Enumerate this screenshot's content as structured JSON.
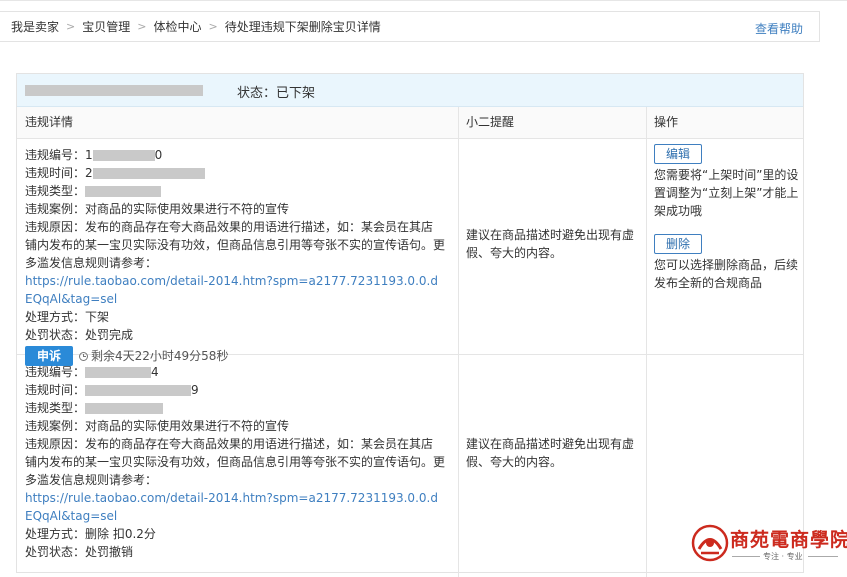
{
  "breadcrumb": [
    "我是卖家",
    "宝贝管理",
    "体检中心",
    "待处理违规下架删除宝贝详情"
  ],
  "breadcrumb_sep": ">",
  "help_label": "查看帮助",
  "status": "状态：已下架",
  "columns": {
    "detail": "违规详情",
    "tip": "小二提醒",
    "action": "操作"
  },
  "records": [
    {
      "id_label": "违规编号：",
      "id_prefix": "1",
      "id_suffix": "0",
      "time_label": "违规时间：",
      "time_prefix": "2",
      "type_label": "违规类型：",
      "case_label": "违规案例：",
      "case": "对商品的实际使用效果进行不符的宣传",
      "reason_label": "违规原因：",
      "reason": "发布的商品存在夸大商品效果的用语进行描述，如：某会员在其店铺内发布的某一宝贝实际没有功效，但商品信息引用等夸张不实的宣传语句。更多滥发信息规则请参考：",
      "rule_link": "https://rule.taobao.com/detail-2014.htm?spm=a2177.7231193.0.0.dEQqAl&tag=sel",
      "method_label": "处理方式：",
      "method": "下架",
      "state_label": "处罚状态：",
      "state": "处罚完成",
      "appeal_label": "申诉",
      "countdown": "剩余4天22小时49分58秒",
      "tip": "建议在商品描述时避免出现有虚假、夸大的内容。"
    },
    {
      "id_label": "违规编号：",
      "id_prefix": "",
      "id_suffix": "4",
      "time_label": "违规时间：",
      "time_prefix": "",
      "time_suffix": "9",
      "type_label": "违规类型：",
      "case_label": "违规案例：",
      "case": "对商品的实际使用效果进行不符的宣传",
      "reason_label": "违规原因：",
      "reason": "发布的商品存在夸大商品效果的用语进行描述，如：某会员在其店铺内发布的某一宝贝实际没有功效，但商品信息引用等夸张不实的宣传语句。更多滥发信息规则请参考：",
      "rule_link": "https://rule.taobao.com/detail-2014.htm?spm=a2177.7231193.0.0.dEQqAl&tag=sel",
      "method_label": "处理方式：",
      "method": "删除 扣0.2分",
      "state_label": "处罚状态：",
      "state": "处罚撤销",
      "tip": "建议在商品描述时避免出现有虚假、夸大的内容。"
    }
  ],
  "actions": {
    "edit_label": "编辑",
    "edit_desc": "您需要将“上架时间”里的设置调整为“立刻上架”才能上架成功哦",
    "delete_label": "删除",
    "delete_desc": "您可以选择删除商品，后续发布全新的合规商品"
  },
  "logo": {
    "name": "商苑電商學院",
    "slogan": "专注 · 专业"
  },
  "colors": {
    "link": "#3f7fc0",
    "primary_button": "#2a8ad8",
    "status_bar": "#eaf6fd",
    "logo_red": "#cc2a1e"
  }
}
